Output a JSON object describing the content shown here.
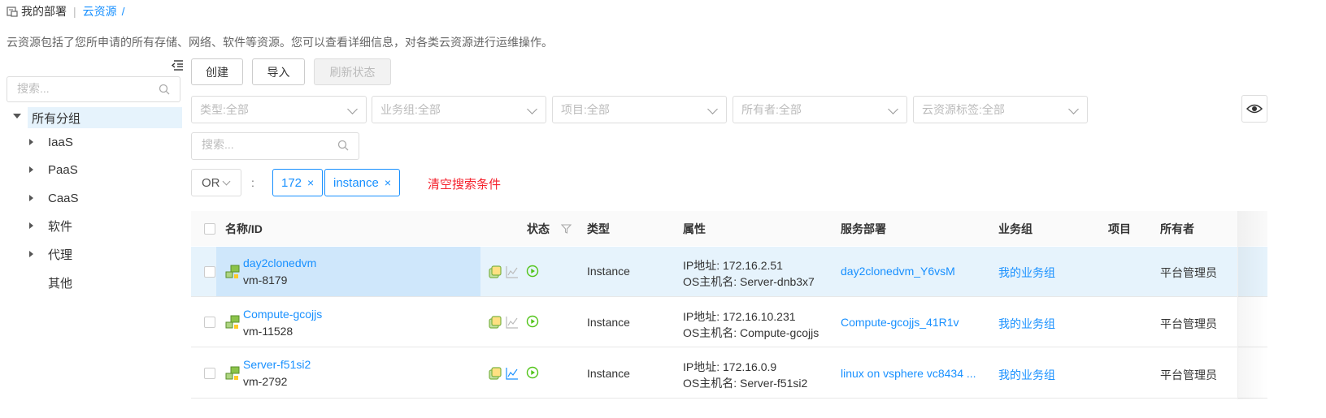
{
  "breadcrumb": {
    "home": "我的部署",
    "current": "云资源",
    "slash": "/"
  },
  "description": "云资源包括了您所申请的所有存储、网络、软件等资源。您可以查看详细信息，对各类云资源进行运维操作。",
  "sidebar": {
    "search_placeholder": "搜索...",
    "root": "所有分组",
    "items": [
      {
        "label": "IaaS",
        "expandable": true
      },
      {
        "label": "PaaS",
        "expandable": true
      },
      {
        "label": "CaaS",
        "expandable": true
      },
      {
        "label": "软件",
        "expandable": true
      },
      {
        "label": "代理",
        "expandable": true
      },
      {
        "label": "其他",
        "expandable": false
      }
    ]
  },
  "toolbar": {
    "create": "创建",
    "import": "导入",
    "refresh": "刷新状态"
  },
  "filters": [
    "类型:全部",
    "业务组:全部",
    "项目:全部",
    "所有者:全部",
    "云资源标签:全部"
  ],
  "search_placeholder": "搜索...",
  "condition": {
    "operator": "OR",
    "colon": ":",
    "tags": [
      {
        "label": "172",
        "close": "×"
      },
      {
        "label": "instance",
        "close": "×"
      }
    ],
    "clear": "清空搜索条件"
  },
  "table": {
    "headers": {
      "name": "名称/ID",
      "status": "状态",
      "type": "类型",
      "attr": "属性",
      "deploy": "服务部署",
      "group": "业务组",
      "project": "项目",
      "owner": "所有者"
    },
    "rows": [
      {
        "name": "day2clonedvm",
        "id": "vm-8179",
        "type": "Instance",
        "ip": "IP地址: 172.16.2.51",
        "host": "OS主机名: Server-dnb3x7",
        "deploy": "day2clonedvm_Y6vsM",
        "group": "我的业务组",
        "project": "",
        "owner": "平台管理员",
        "selected": true
      },
      {
        "name": "Compute-gcojjs",
        "id": "vm-11528",
        "type": "Instance",
        "ip": "IP地址: 172.16.10.231",
        "host": "OS主机名: Compute-gcojjs",
        "deploy": "Compute-gcojjs_41R1v",
        "group": "我的业务组",
        "project": "",
        "owner": "平台管理员",
        "selected": false
      },
      {
        "name": "Server-f51si2",
        "id": "vm-2792",
        "type": "Instance",
        "ip": "IP地址: 172.16.0.9",
        "host": "OS主机名: Server-f51si2",
        "deploy": "linux on vsphere vc8434 ...",
        "group": "我的业务组",
        "project": "",
        "owner": "平台管理员",
        "selected": false
      }
    ]
  },
  "colors": {
    "accent": "#1890ff",
    "danger": "#f5222d",
    "running": "#52c41a",
    "selected_row": "#e6f3fc"
  }
}
